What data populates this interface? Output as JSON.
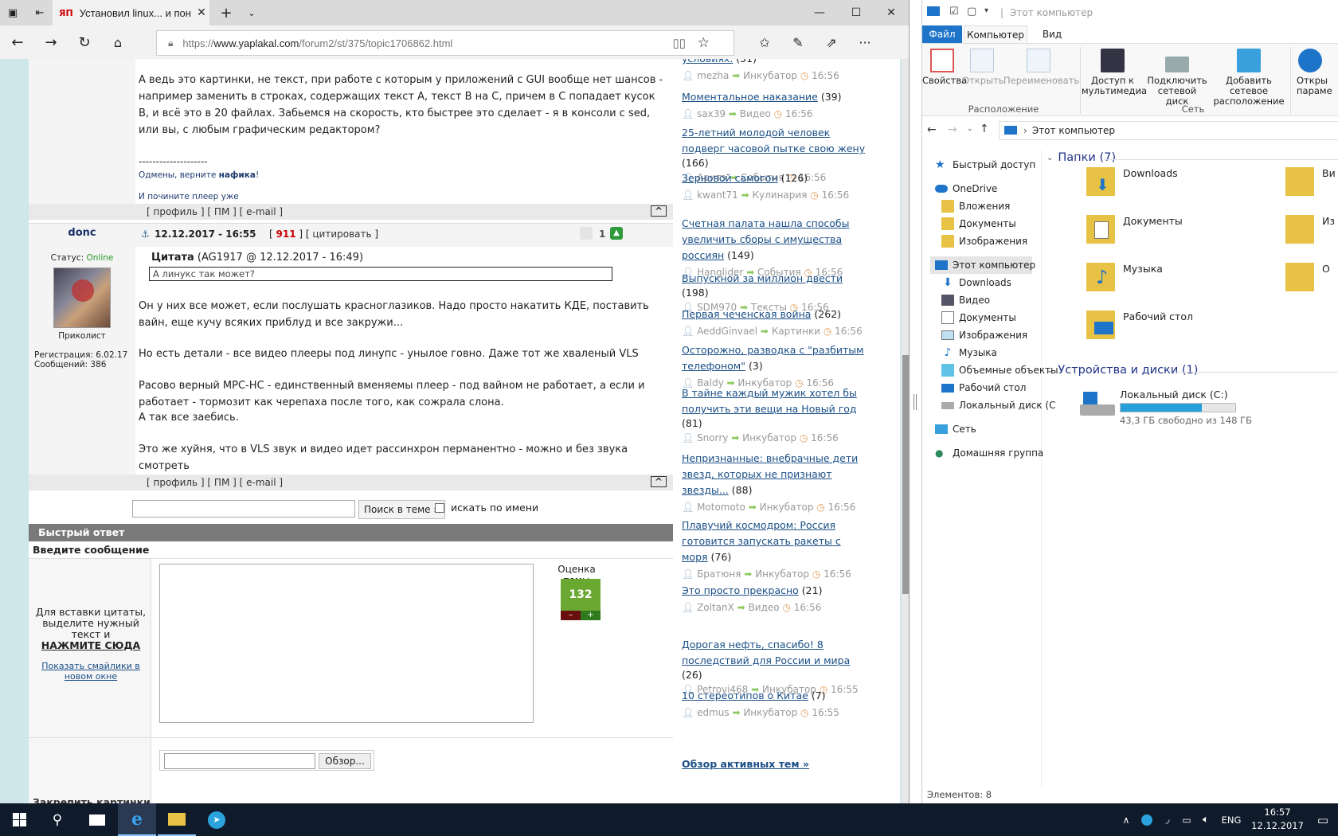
{
  "browser": {
    "tab_title": "Установил linux... и пон",
    "tab_favicon": "ЯП",
    "url_prefix": "https://",
    "url_host": "www.yaplakal.com",
    "url_path": "/forum2/st/375/topic1706862.html"
  },
  "post1": {
    "paragraph": "А ведь это картинки, не текст, при работе с которым у приложений с GUI вообще нет шансов - например заменить в строках, содержащих текст А, текст B на C, причем в C попадает кусок B, и всё это в 20 файлах. Забьемся на скорость, кто быстрее это сделает - я в консоли с sed, или вы, с любым графическим редактором?",
    "sig_dashes": "--------------------",
    "sig_line1_a": "Одмены, верните ",
    "sig_line1_b": "нафика",
    "sig_line1_c": "!",
    "sig_line2": "И почините плеер уже"
  },
  "post_links": {
    "profile": "профиль",
    "pm": "ПМ",
    "email": "e-mail",
    "up": "^"
  },
  "post2": {
    "author": "donc",
    "date": "12.12.2017 - 16:55",
    "rating": "911",
    "quote_action": "цитировать",
    "likes": "1",
    "status_label": "Статус:",
    "status_value": "Online",
    "rank": "Приколист",
    "reg": "Регистрация: 6.02.17",
    "msgs": "Сообщений: 386",
    "quote_head_bold": "Цитата",
    "quote_head_rest": " (AG1917 @ 12.12.2017 - 16:49)",
    "quote_text": "А линукс так может?",
    "p1": "Он у них все может, если послушать красноглазиков. Надо просто накатить КДЕ, поставить вайн, еще кучу всяких приблуд и все закружи...",
    "p2": "Но есть детали - все видео плееры под линупс - унылое говно. Даже тот же хваленый VLS",
    "p3": "Расово верный MPC-HC - единственный вменяемы плеер - под вайном не работает, а если и работает - тормозит как черепаха после того, как сожрала слона.",
    "p4": "А так все заебись.",
    "p5": "Это же хуйня, что в VLS звук и видео идет рассинхрон перманентно - можно и без звука смотреть"
  },
  "search": {
    "button": "Поиск в теме »",
    "by_name": "искать по имени"
  },
  "quick_reply": {
    "header": "Быстрый ответ",
    "enter_msg": "Введите сообщение",
    "hint1": "Для вставки цитаты, выделите нужный текст и",
    "hint_bold": "НАЖМИТЕ СЮДА",
    "smiles": "Показать смайлики в новом окне",
    "rating_label": "Оценка темы",
    "rating_value": "132",
    "minus": "–",
    "plus": "+",
    "attach_label": "Закрепить картинки",
    "browse": "Обзор..."
  },
  "topics": [
    {
      "title": "условиях.",
      "count": "(51)",
      "user": "mezha",
      "section": "Инкубатор",
      "time": "16:56"
    },
    {
      "title": "Моментальное наказание",
      "count": "(39)",
      "user": "sax39",
      "section": "Видео",
      "time": "16:56"
    },
    {
      "title": "25-летний молодой человек подверг часовой пытке свою жену",
      "count": "(166)",
      "user": "Аритэ",
      "section": "События",
      "time": "16:56"
    },
    {
      "title": "Зерновой самогон",
      "count": "(126)",
      "user": "kwant71",
      "section": "Кулинария",
      "time": "16:56"
    },
    {
      "title": "Счетная палата нашла способы увеличить сборы с имущества россиян",
      "count": "(149)",
      "user": "Hanglider",
      "section": "События",
      "time": "16:56"
    },
    {
      "title": "Выпускной за миллион двести",
      "count": "(198)",
      "user": "SDM970",
      "section": "Тексты",
      "time": "16:56"
    },
    {
      "title": "Первая чеченская война",
      "count": "(262)",
      "user": "AeddGinvael",
      "section": "Картинки",
      "time": "16:56"
    },
    {
      "title": "Осторожно, разводка с \"разбитым телефоном\"",
      "count": "(3)",
      "user": "Baldy",
      "section": "Инкубатор",
      "time": "16:56"
    },
    {
      "title": "В тайне каждый мужик хотел бы получить эти вещи на Новый год",
      "count": "(81)",
      "user": "Snorry",
      "section": "Инкубатор",
      "time": "16:56"
    },
    {
      "title": "Непризнанные: внебрачные дети звезд, которых не признают звезды...",
      "count": "(88)",
      "user": "Motomoto",
      "section": "Инкубатор",
      "time": "16:56"
    },
    {
      "title": "Плавучий космодром: Россия готовится запускать ракеты с моря",
      "count": "(76)",
      "user": "Братюня",
      "section": "Инкубатор",
      "time": "16:56"
    },
    {
      "title": "Это просто прекрасно",
      "count": "(21)",
      "user": "ZoltanX",
      "section": "Видео",
      "time": "16:56"
    },
    {
      "title": "Дорогая нефть, спасибо! 8 последствий для России и мира",
      "count": "(26)",
      "user": "Petrovi468",
      "section": "Инкубатор",
      "time": "16:55"
    },
    {
      "title": "10 стереотипов о Китае",
      "count": "(7)",
      "user": "edmus",
      "section": "Инкубатор",
      "time": "16:55"
    }
  ],
  "active_topics": "Обзор активных тем »",
  "explorer": {
    "title": "Этот компьютер",
    "tabs": [
      "Файл",
      "Компьютер",
      "Вид"
    ],
    "ribbon": {
      "properties": "Свойства",
      "open": "Открыть",
      "rename": "Переименовать",
      "media_access": "Доступ к мультимедиа",
      "map_drive": "Подключить сетевой диск",
      "add_location": "Добавить сетевое расположение",
      "open_params": "Откры параме",
      "group_location": "Расположение",
      "group_network": "Сеть"
    },
    "address": "Этот компьютер",
    "nav": {
      "quick_access": "Быстрый доступ",
      "onedrive": "OneDrive",
      "attachments": "Вложения",
      "documents_od": "Документы",
      "images_od": "Изображения",
      "this_pc": "Этот компьютер",
      "downloads": "Downloads",
      "video": "Видео",
      "documents": "Документы",
      "images": "Изображения",
      "music": "Музыка",
      "objects3d": "Объемные объекты",
      "desktop": "Рабочий стол",
      "local_disk": "Локальный диск (C",
      "network": "Сеть",
      "homegroup": "Домашняя группа"
    },
    "folders_header": "Папки (7)",
    "folders": {
      "downloads": "Downloads",
      "documents": "Документы",
      "music": "Музыка",
      "desktop": "Рабочий стол",
      "video_partial": "Ви",
      "images_partial": "Из",
      "objects_partial": "О"
    },
    "devices_header": "Устройства и диски (1)",
    "disk": {
      "name": "Локальный диск (C:)",
      "free": "43,3 ГБ свободно из 148 ГБ",
      "used_fraction": 0.71
    },
    "status": "Элементов: 8"
  },
  "taskbar": {
    "lang": "ENG",
    "time": "16:57",
    "date": "12.12.2017"
  }
}
